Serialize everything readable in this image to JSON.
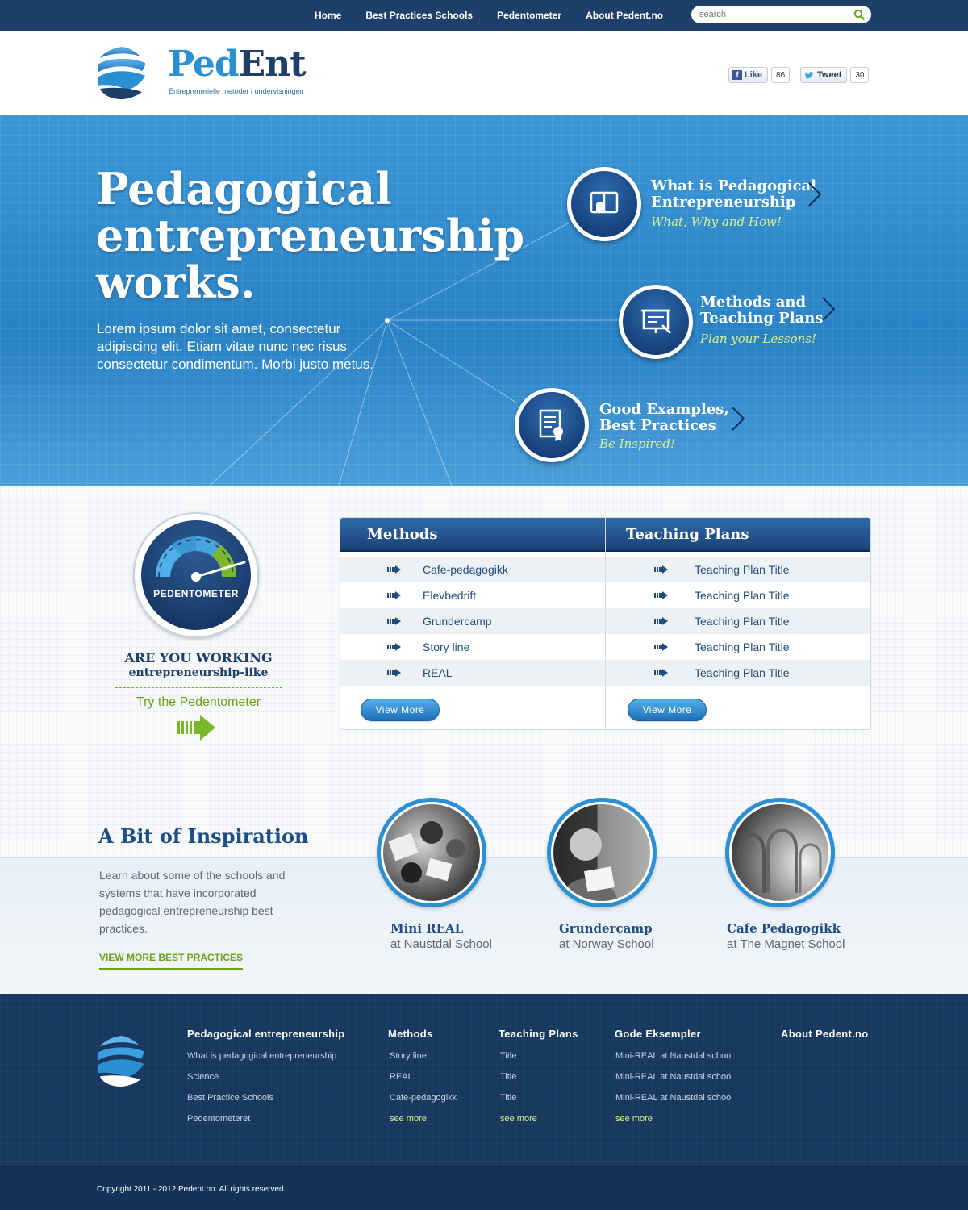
{
  "topnav": {
    "links": [
      "Home",
      "Best Practices Schools",
      "Pedentometer",
      "About Pedent.no"
    ],
    "search_placeholder": "search"
  },
  "header": {
    "brand_ped": "Ped",
    "brand_ent": "Ent",
    "tagline": "Entreprenørielle metoder i undervisningen",
    "like_label": "Like",
    "like_count": "86",
    "tweet_label": "Tweet",
    "tweet_count": "30"
  },
  "hero": {
    "title_1": "Pedagogical",
    "title_2": "entrepreneurship",
    "title_3": "works.",
    "text": "Lorem ipsum dolor sit amet, consectetur adipiscing elit. Etiam vitae nunc nec risus consectetur condimentum. Morbi justo metus.",
    "features": [
      {
        "title_1": "What is Pedagogical",
        "title_2": "Entrepreneurship",
        "subtitle": "What, Why and How!"
      },
      {
        "title_1": "Methods and",
        "title_2": "Teaching Plans",
        "subtitle": "Plan your Lessons!"
      },
      {
        "title_1": "Good Examples,",
        "title_2": "Best Practices",
        "subtitle": "Be Inspired!"
      }
    ]
  },
  "pedentometer": {
    "label": "PEDENTOMETER",
    "question_1": "ARE YOU WORKING",
    "question_2": "entrepreneurship-like",
    "cta": "Try the Pedentometer"
  },
  "methods": {
    "title": "Methods",
    "items": [
      "Cafe-pedagogikk",
      "Elevbedrift",
      "Grundercamp",
      "Story line",
      "REAL"
    ],
    "view_more": "View More"
  },
  "teaching_plans": {
    "title": "Teaching Plans",
    "items": [
      "Teaching Plan Title",
      "Teaching Plan Title",
      "Teaching Plan Title",
      "Teaching Plan Title",
      "Teaching Plan Title"
    ],
    "view_more": "View More"
  },
  "inspiration": {
    "title": "A Bit of Inspiration",
    "text": "Learn about some of the schools and systems that have incorporated pedagogical entrepreneurship best practices.",
    "link": "VIEW MORE BEST PRACTICES",
    "examples": [
      {
        "title": "Mini REAL",
        "subtitle": "at Naustdal School"
      },
      {
        "title": "Grundercamp",
        "subtitle": "at Norway School"
      },
      {
        "title": "Cafe Pedagogikk",
        "subtitle": "at The Magnet School"
      }
    ]
  },
  "footer": {
    "columns": [
      {
        "title": "Pedagogical entrepreneurship",
        "links": [
          "What is pedagogical entrepreneurship",
          "Science",
          "Best Practice Schools",
          "Pedentometeret"
        ]
      },
      {
        "title": "Methods",
        "links": [
          "Story line",
          "REAL",
          "Cafe-pedagogikk"
        ],
        "more": "see more"
      },
      {
        "title": "Teaching Plans",
        "links": [
          "Title",
          "Title",
          "Title"
        ],
        "more": "see more"
      },
      {
        "title": "Gode Eksempler",
        "links": [
          "Mini-REAL at Naustdal school",
          "Mini-REAL at Naustdal school",
          "Mini-REAL at Naustdal school"
        ],
        "more": "see more"
      },
      {
        "title": "About Pedent.no",
        "links": []
      }
    ],
    "copyright": "Copyright 2011 - 2012  Pedent.no. All rights reserved."
  },
  "colors": {
    "navy": "#1f3f6b",
    "hero_blue": "#2a85c8",
    "accent_green": "#6aa218",
    "highlight_yellow": "#d9f08c"
  }
}
